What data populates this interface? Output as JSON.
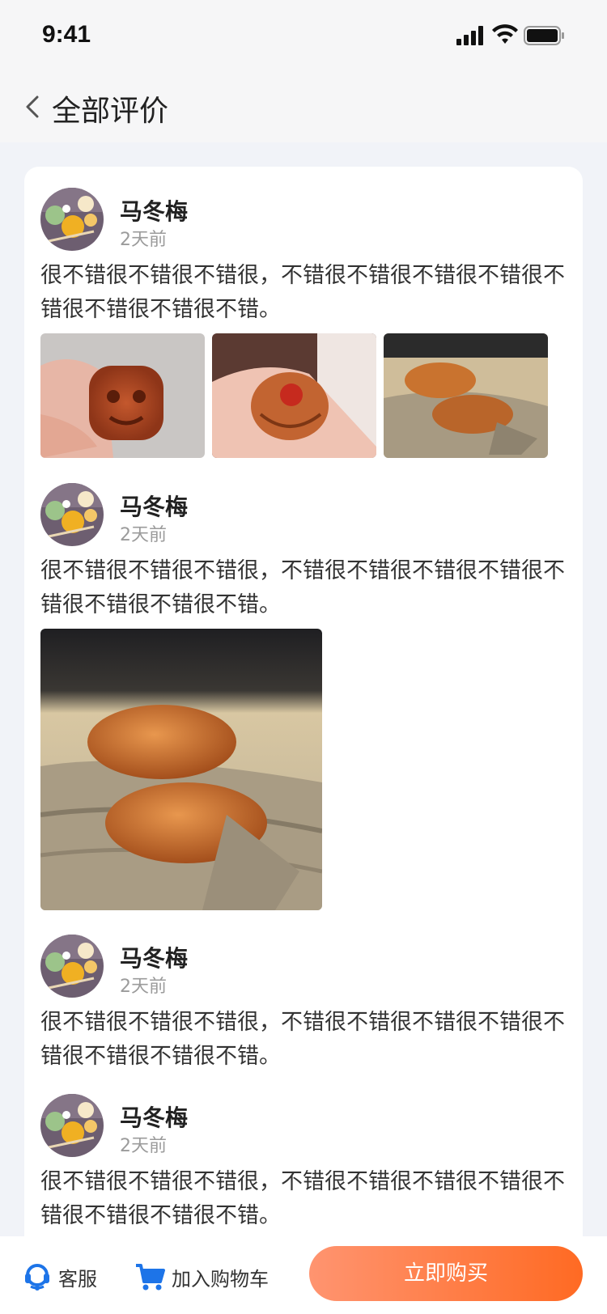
{
  "status": {
    "time": "9:41"
  },
  "nav": {
    "title": "全部评价"
  },
  "reviews": [
    {
      "name": "马冬梅",
      "time": "2天前",
      "text": "很不错很不错很不错很，不错很不错很不错很不错很不错很不错很不错很不错。"
    },
    {
      "name": "马冬梅",
      "time": "2天前",
      "text": "很不错很不错很不错很，不错很不错很不错很不错很不错很不错很不错很不错。"
    },
    {
      "name": "马冬梅",
      "time": "2天前",
      "text": "很不错很不错很不错很，不错很不错很不错很不错很不错很不错很不错很不错。"
    },
    {
      "name": "马冬梅",
      "time": "2天前",
      "text": "很不错很不错很不错很，不错很不错很不错很不错很不错很不错很不错很不错。"
    }
  ],
  "bottom": {
    "service_label": "客服",
    "cart_label": "加入购物车",
    "buy_label": "立即购买"
  },
  "colors": {
    "accent_start": "#ff9470",
    "accent_end": "#ff6a23",
    "icon_blue": "#1d74e8"
  },
  "icons": [
    "back-chevron-icon",
    "signal-icon",
    "wifi-icon",
    "battery-icon",
    "customer-service-icon",
    "cart-icon"
  ]
}
